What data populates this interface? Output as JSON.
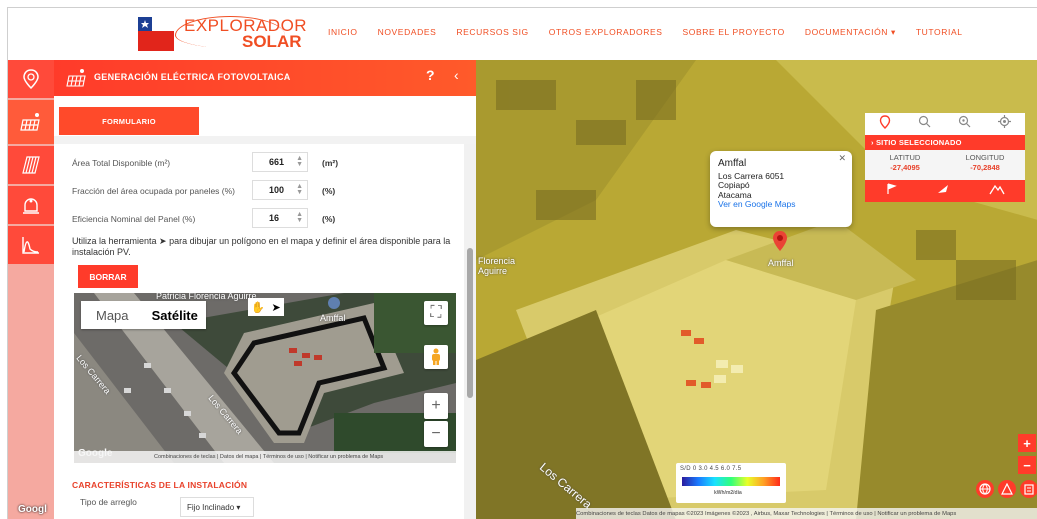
{
  "header": {
    "logo": {
      "line1": "EXPLORADOR",
      "line2": "SOLAR"
    },
    "nav": [
      "INICIO",
      "NOVEDADES",
      "RECURSOS SIG",
      "OTROS EXPLORADORES",
      "SOBRE EL PROYECTO",
      "DOCUMENTACIÓN ▾",
      "TUTORIAL"
    ]
  },
  "rail": {
    "icons": [
      "location-pin-icon",
      "solar-panel-icon",
      "solar-collector-icon",
      "water-heater-icon",
      "chart-icon"
    ]
  },
  "panel": {
    "title": "GENERACIÓN ELÉCTRICA FOTOVOLTAICA",
    "help": "?",
    "collapse": "‹",
    "tab": "FORMULARIO",
    "fields": [
      {
        "label": "Área Total Disponible (m²)",
        "value": "661",
        "unit": "(m²)"
      },
      {
        "label": "Fracción del área ocupada por paneles (%)",
        "value": "100",
        "unit": "(%)"
      },
      {
        "label": "Eficiencia Nominal del Panel (%)",
        "value": "16",
        "unit": "(%)"
      }
    ],
    "help_text": "Utiliza la herramienta ➤ para dibujar un polígono en el mapa y definir el área disponible para la instalación PV.",
    "clear_button": "BORRAR",
    "minimap": {
      "map_type": [
        "Mapa",
        "Satélite"
      ],
      "selected_type": "Satélite",
      "place_label": "Amffal",
      "street_labels": [
        "Los Carrera",
        "Los Carrera",
        "Patricia Florencia Aguirre"
      ],
      "footer": "Combinaciones de teclas | Datos del mapa | Términos de uso | Notificar un problema de Maps",
      "google": "Google"
    },
    "section_title": "CARACTERÍSTICAS DE LA INSTALACIÓN",
    "arreglo_label": "Tipo de arreglo",
    "arreglo_value": "Fijo Inclinado ▾"
  },
  "map": {
    "infowindow": {
      "name": "Amffal",
      "address": "Los Carrera 6051",
      "city": "Copiapó",
      "region": "Atacama",
      "link": "Ver en Google Maps"
    },
    "marker_label": "Amffal",
    "labels": [
      "Florencia",
      "Aguirre",
      "Los Carrera"
    ],
    "site": {
      "title": "SITIO SELECCIONADO",
      "lat_label": "LATITUD",
      "lat_value": "-27,4095",
      "lon_label": "LONGITUD",
      "lon_value": "-70,2848"
    },
    "legend": {
      "values": "S/D  0   3.0   4.5  6.0  7.5",
      "unit": "kWh/m2/día"
    },
    "zoom_in": "+",
    "zoom_out": "−",
    "footer": "Combinaciones de teclas   Datos de mapas ©2023 Imágenes ©2023 , Airbus, Maxar Technologies  |  Términos de uso  |  Notificar un problema de Maps"
  },
  "colors": {
    "accent": "#ff3b2a",
    "map_tint": "#d8c84a"
  }
}
